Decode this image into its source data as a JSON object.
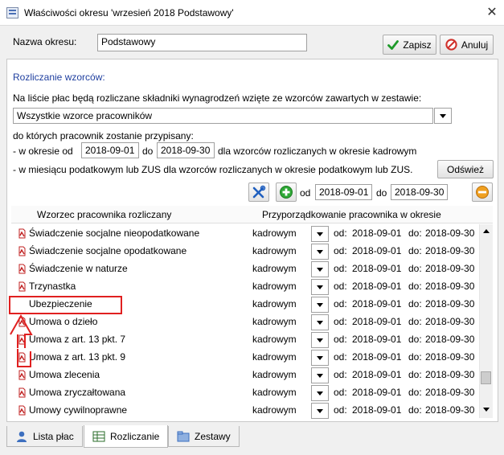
{
  "window": {
    "title": "Właściwości okresu 'wrzesień 2018 Podstawowy'",
    "close_symbol": "✕"
  },
  "header": {
    "period_name_label": "Nazwa okresu:",
    "period_name_value": "Podstawowy",
    "save_label": "Zapisz",
    "cancel_label": "Anuluj"
  },
  "settlement": {
    "group_title": "Rozliczanie wzorców:",
    "description": "Na liście płac będą rozliczane składniki wynagrodzeń wzięte ze wzorców zawartych w zestawie:",
    "set_value": "Wszystkie wzorce pracowników",
    "assigned_text": "do których pracownik zostanie przypisany:",
    "period_prefix": "- w okresie od",
    "period_from": "2018-09-01",
    "period_do": "do",
    "period_to": "2018-09-30",
    "period_suffix": "dla wzorców rozliczanych w okresie kadrowym",
    "tax_text": "- w miesiącu podatkowym lub ZUS dla wzorców rozliczanych w okresie podatkowym lub ZUS.",
    "refresh_label": "Odśwież"
  },
  "toolbar": {
    "od_label": "od",
    "from_date": "2018-09-01",
    "do_label": "do",
    "to_date": "2018-09-30"
  },
  "grid": {
    "col1": "Wzorzec pracownika rozliczany",
    "col2": "Przyporządkowanie pracownika w okresie",
    "rows": [
      {
        "name": "Świadczenie socjalne nieopodatkowane",
        "assign": "kadrowym",
        "od": "od:",
        "from": "2018-09-01",
        "do": "do:",
        "to": "2018-09-30"
      },
      {
        "name": "Świadczenie socjalne opodatkowane",
        "assign": "kadrowym",
        "od": "od:",
        "from": "2018-09-01",
        "do": "do:",
        "to": "2018-09-30"
      },
      {
        "name": "Świadczenie w naturze",
        "assign": "kadrowym",
        "od": "od:",
        "from": "2018-09-01",
        "do": "do:",
        "to": "2018-09-30"
      },
      {
        "name": "Trzynastka",
        "assign": "kadrowym",
        "od": "od:",
        "from": "2018-09-01",
        "do": "do:",
        "to": "2018-09-30"
      },
      {
        "name": "Ubezpieczenie",
        "assign": "kadrowym",
        "od": "od:",
        "from": "2018-09-01",
        "do": "do:",
        "to": "2018-09-30"
      },
      {
        "name": "Umowa o dzieło",
        "assign": "kadrowym",
        "od": "od:",
        "from": "2018-09-01",
        "do": "do:",
        "to": "2018-09-30"
      },
      {
        "name": "Umowa z art. 13 pkt. 7",
        "assign": "kadrowym",
        "od": "od:",
        "from": "2018-09-01",
        "do": "do:",
        "to": "2018-09-30"
      },
      {
        "name": "Umowa z art. 13 pkt. 9",
        "assign": "kadrowym",
        "od": "od:",
        "from": "2018-09-01",
        "do": "do:",
        "to": "2018-09-30"
      },
      {
        "name": "Umowa zlecenia",
        "assign": "kadrowym",
        "od": "od:",
        "from": "2018-09-01",
        "do": "do:",
        "to": "2018-09-30"
      },
      {
        "name": "Umowa zryczałtowana",
        "assign": "kadrowym",
        "od": "od:",
        "from": "2018-09-01",
        "do": "do:",
        "to": "2018-09-30"
      },
      {
        "name": "Umowy cywilnoprawne",
        "assign": "kadrowym",
        "od": "od:",
        "from": "2018-09-01",
        "do": "do:",
        "to": "2018-09-30"
      }
    ]
  },
  "tabs": [
    {
      "label": "Lista płac"
    },
    {
      "label": "Rozliczanie"
    },
    {
      "label": "Zestawy"
    }
  ],
  "colors": {
    "accent_blue": "#1f3f9f",
    "highlight_red": "#e02020",
    "save_green": "#1e9a2a",
    "cancel_red": "#d0302a"
  },
  "icons": {
    "save": "check-icon",
    "cancel": "cancel-icon",
    "tools": "tools-icon",
    "add": "plus-icon",
    "remove": "minus-icon",
    "document": "document-icon"
  }
}
